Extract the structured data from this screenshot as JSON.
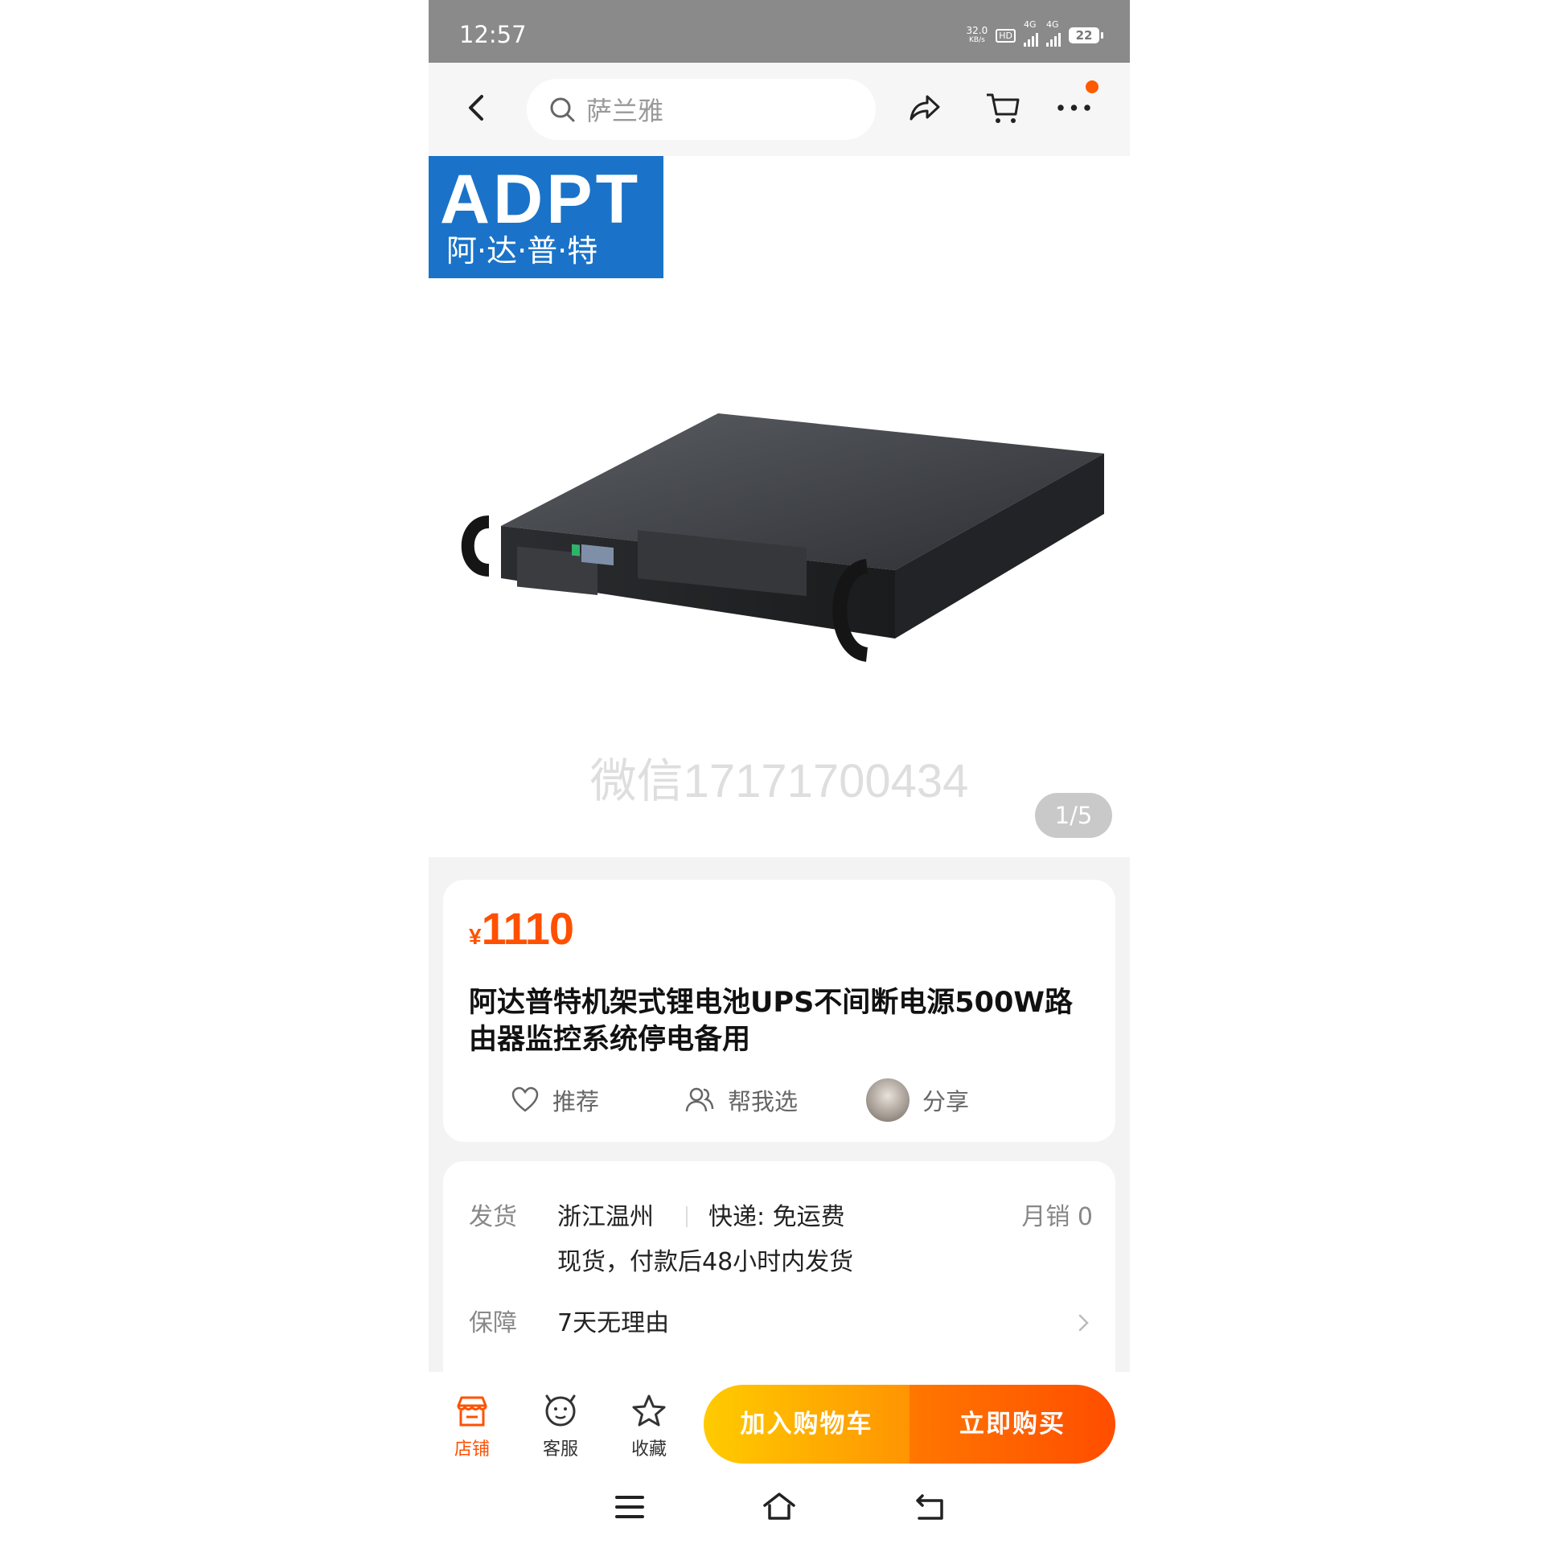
{
  "status_bar": {
    "time": "12:57",
    "net_speed_value": "32.0",
    "net_speed_unit": "KB/s",
    "hd_label": "HD",
    "signal_1_label": "4G",
    "signal_2_label": "4G",
    "battery": "22"
  },
  "search": {
    "placeholder": "萨兰雅"
  },
  "gallery": {
    "brand_logo_en": "ADPT",
    "brand_logo_cn": "阿·达·普·特",
    "watermark": "微信17171700434",
    "counter": "1/5"
  },
  "product": {
    "currency": "¥",
    "price": "1110",
    "title": "阿达普特机架式锂电池UPS不间断电源500W路由器监控系统停电备用",
    "actions": {
      "recommend": "推荐",
      "help_choose": "帮我选",
      "share": "分享"
    }
  },
  "shipping": {
    "label": "发货",
    "origin": "浙江温州",
    "express": "快递: 免运费",
    "monthly_sales": "月销  0",
    "note": "现货，付款后48小时内发货"
  },
  "guarantee": {
    "label": "保障",
    "value": "7天无理由"
  },
  "bottom_bar": {
    "store": "店铺",
    "service": "客服",
    "favorite": "收藏",
    "add_to_cart": "加入购物车",
    "buy_now": "立即购买"
  },
  "colors": {
    "accent": "#ff5000",
    "cart_button": "#ffa502",
    "buy_button": "#ff5a00",
    "brand_blue": "#1a73c9",
    "status_bar": "#8a8a8a"
  },
  "icons": [
    "back-icon",
    "search-icon",
    "share-icon",
    "cart-icon",
    "more-icon",
    "heart-icon",
    "people-icon",
    "store-icon",
    "service-icon",
    "star-icon",
    "menu-icon",
    "home-icon",
    "return-icon",
    "chevron-right-icon"
  ]
}
